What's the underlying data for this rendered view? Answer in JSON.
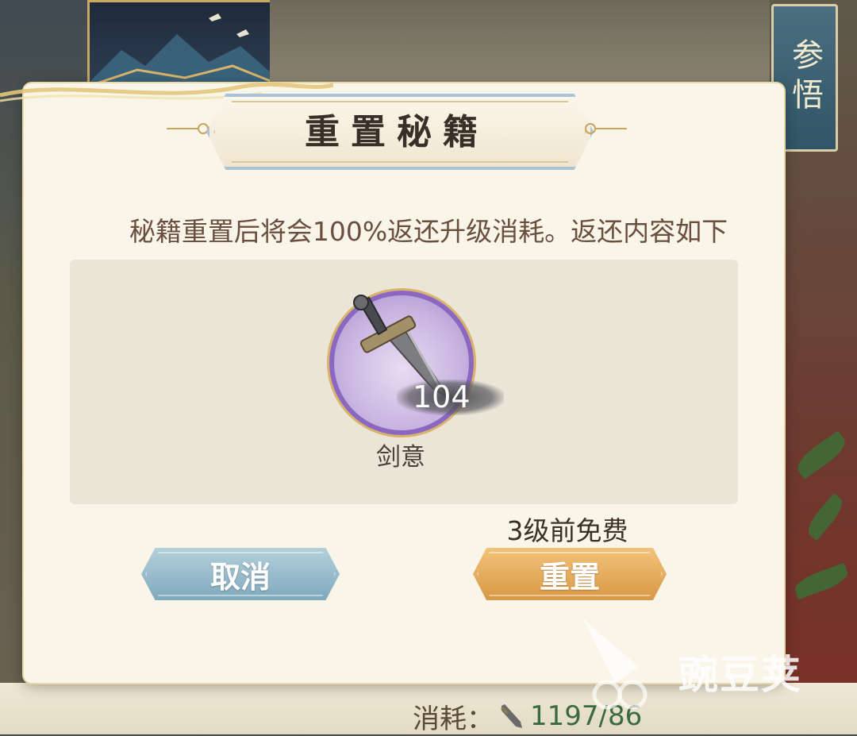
{
  "background": {
    "side_banner_text": "参悟",
    "cost": {
      "label": "消耗：",
      "icon": "sword-icon",
      "count": "1197/86"
    }
  },
  "dialog": {
    "title": "重置秘籍",
    "description": "秘籍重置后将会100%返还升级消耗。返还内容如下",
    "reward_item": {
      "icon": "sword-icon",
      "count": "104",
      "name": "剑意"
    },
    "free_note": "3级前免费",
    "cancel_label": "取消",
    "confirm_label": "重置"
  },
  "watermark": {
    "text": "豌豆荚",
    "logo": "wandoujia-logo"
  },
  "colors": {
    "dialog_bg": "#f9f5e9",
    "cancel_button": "#8fb4c6",
    "confirm_button": "#e0a550",
    "item_ring": "#8a67c0"
  }
}
